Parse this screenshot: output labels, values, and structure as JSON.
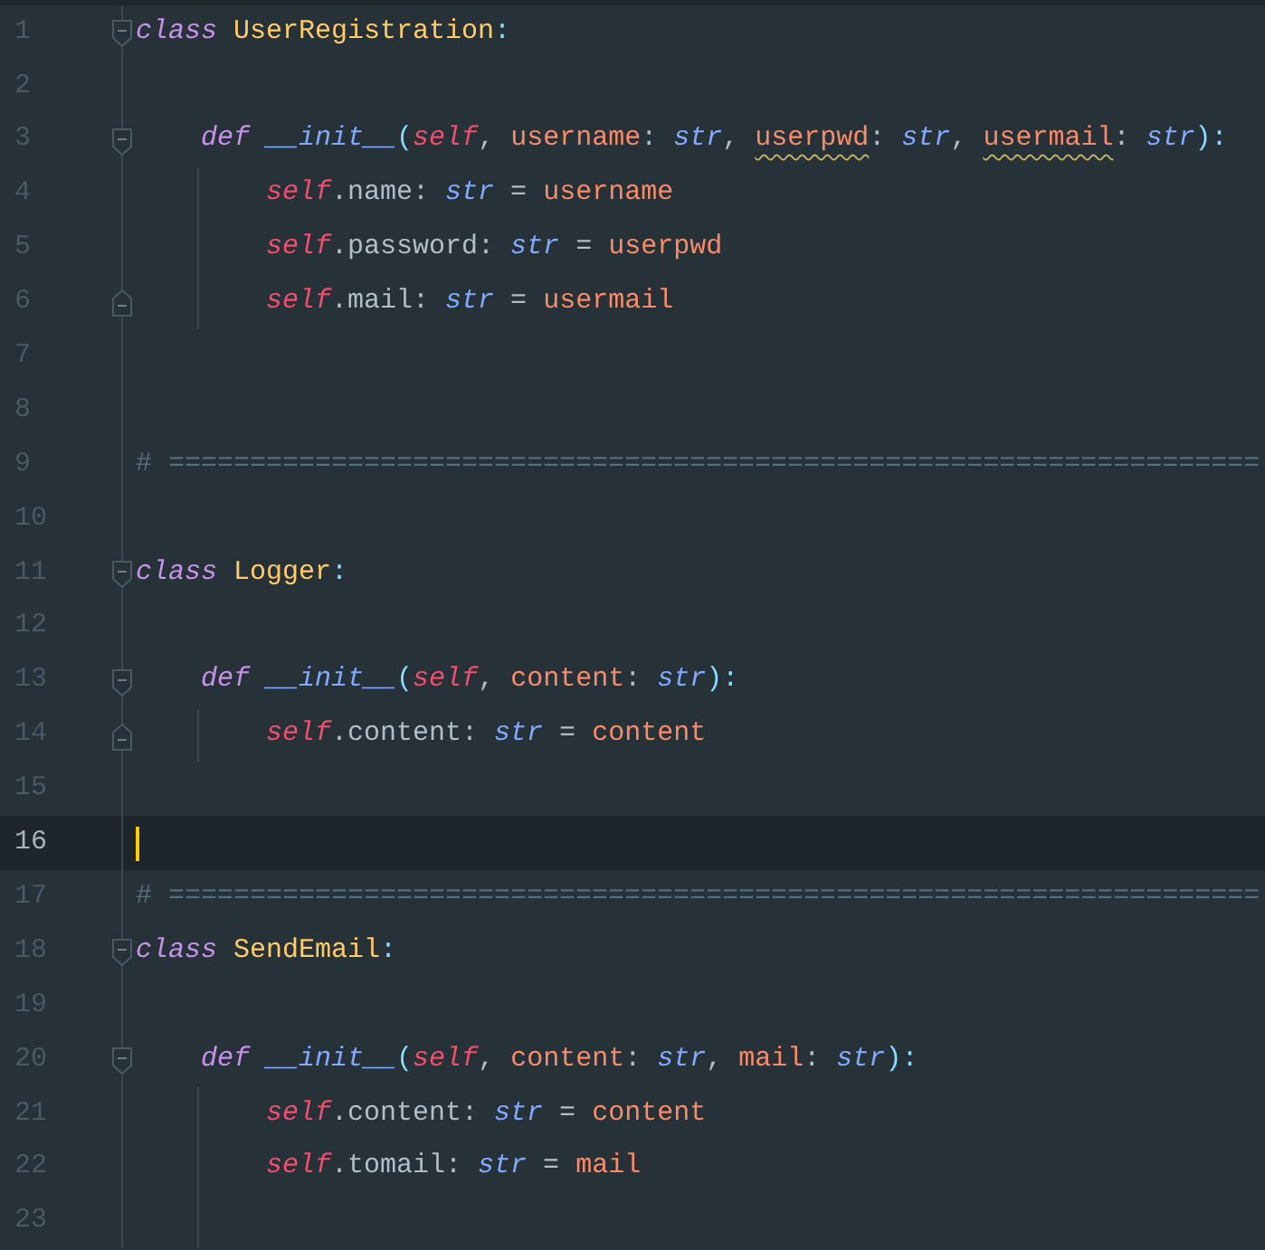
{
  "editor": {
    "lines": [
      {
        "number": "1",
        "current": false,
        "fold": {
          "kind": "start"
        },
        "tokens": [
          {
            "kind": "keyword",
            "text": "class"
          },
          {
            "kind": "classname",
            "text": "UserRegistration",
            "space_before": true
          },
          {
            "kind": "punct",
            "text": ":"
          }
        ],
        "children": [
          {
            "number": "2",
            "current": false
          },
          {
            "number": "3",
            "current": false,
            "fold": {
              "kind": "start"
            },
            "tokens": [
              {
                "kind": "keyword",
                "text": "def",
                "warning": false
              },
              {
                "kind": "function",
                "text": "__init__",
                "space_before": true,
                "warning": false
              },
              {
                "kind": "punct",
                "text": "(",
                "warning": false
              },
              {
                "kind": "self",
                "text": "self",
                "warning": false
              },
              {
                "kind": "plain",
                "text": ", ",
                "warning": false
              },
              {
                "kind": "param",
                "text": "username",
                "warning": false
              },
              {
                "kind": "plain",
                "text": ": ",
                "warning": false
              },
              {
                "kind": "type",
                "text": "str",
                "warning": false
              },
              {
                "kind": "plain",
                "text": ", ",
                "warning": false
              },
              {
                "kind": "param",
                "text": "userpwd",
                "warning": true
              },
              {
                "kind": "plain",
                "text": ": ",
                "warning": false
              },
              {
                "kind": "type",
                "text": "str",
                "warning": false
              },
              {
                "kind": "plain",
                "text": ", ",
                "warning": false
              },
              {
                "kind": "param",
                "text": "usermail",
                "warning": true
              },
              {
                "kind": "plain",
                "text": ": ",
                "warning": false
              },
              {
                "kind": "type",
                "text": "str",
                "warning": false
              },
              {
                "kind": "punct",
                "text": "):",
                "warning": false
              }
            ],
            "children": [
              {
                "number": "4",
                "current": false,
                "tokens": [
                  {
                    "kind": "self",
                    "text": "self"
                  },
                  {
                    "kind": "plain",
                    "text": ".name: "
                  },
                  {
                    "kind": "type",
                    "text": "str"
                  },
                  {
                    "kind": "plain",
                    "text": " = "
                  },
                  {
                    "kind": "param",
                    "text": "username"
                  }
                ]
              },
              {
                "number": "5",
                "current": false,
                "tokens": [
                  {
                    "kind": "self",
                    "text": "self"
                  },
                  {
                    "kind": "plain",
                    "text": ".password: "
                  },
                  {
                    "kind": "type",
                    "text": "str"
                  },
                  {
                    "kind": "plain",
                    "text": " = "
                  },
                  {
                    "kind": "param",
                    "text": "userpwd"
                  }
                ]
              },
              {
                "number": "6",
                "current": false,
                "fold": {
                  "kind": "end"
                },
                "tokens": [
                  {
                    "kind": "self",
                    "text": "self"
                  },
                  {
                    "kind": "plain",
                    "text": ".mail: "
                  },
                  {
                    "kind": "type",
                    "text": "str"
                  },
                  {
                    "kind": "plain",
                    "text": " = "
                  },
                  {
                    "kind": "param",
                    "text": "usermail"
                  }
                ]
              }
            ]
          }
        ]
      },
      {
        "number": "7",
        "current": false
      },
      {
        "number": "8",
        "current": false
      },
      {
        "number": "9",
        "current": false,
        "tokens": [
          {
            "kind": "comment",
            "text": "# ==================================================================="
          }
        ]
      },
      {
        "number": "10",
        "current": false
      },
      {
        "number": "11",
        "current": false,
        "fold": {
          "kind": "start"
        },
        "tokens": [
          {
            "kind": "keyword",
            "text": "class"
          },
          {
            "kind": "classname",
            "text": "Logger",
            "space_before": true
          },
          {
            "kind": "punct",
            "text": ":"
          }
        ],
        "children": [
          {
            "number": "12",
            "current": false
          },
          {
            "number": "13",
            "current": false,
            "fold": {
              "kind": "start"
            },
            "tokens": [
              {
                "kind": "keyword",
                "text": "def"
              },
              {
                "kind": "function",
                "text": "__init__",
                "space_before": true
              },
              {
                "kind": "punct",
                "text": "("
              },
              {
                "kind": "self",
                "text": "self"
              },
              {
                "kind": "plain",
                "text": ", "
              },
              {
                "kind": "param",
                "text": "content"
              },
              {
                "kind": "plain",
                "text": ": "
              },
              {
                "kind": "type",
                "text": "str"
              },
              {
                "kind": "punct",
                "text": "):"
              }
            ],
            "children": [
              {
                "number": "14",
                "current": false,
                "fold": {
                  "kind": "end"
                },
                "tokens": [
                  {
                    "kind": "self",
                    "text": "self"
                  },
                  {
                    "kind": "plain",
                    "text": ".content: "
                  },
                  {
                    "kind": "type",
                    "text": "str"
                  },
                  {
                    "kind": "plain",
                    "text": " = "
                  },
                  {
                    "kind": "param",
                    "text": "content"
                  }
                ]
              }
            ]
          }
        ]
      },
      {
        "number": "15",
        "current": false
      },
      {
        "number": "16",
        "current": true
      },
      {
        "number": "17",
        "current": false,
        "tokens": [
          {
            "kind": "comment",
            "text": "# ==================================================================="
          }
        ]
      },
      {
        "number": "18",
        "current": false,
        "fold": {
          "kind": "start"
        },
        "tokens": [
          {
            "kind": "keyword",
            "text": "class"
          },
          {
            "kind": "classname",
            "text": "SendEmail",
            "space_before": true
          },
          {
            "kind": "punct",
            "text": ":"
          }
        ],
        "children": [
          {
            "number": "19",
            "current": false
          },
          {
            "number": "20",
            "current": false,
            "fold": {
              "kind": "start"
            },
            "tokens": [
              {
                "kind": "keyword",
                "text": "def"
              },
              {
                "kind": "function",
                "text": "__init__",
                "space_before": true
              },
              {
                "kind": "punct",
                "text": "("
              },
              {
                "kind": "self",
                "text": "self"
              },
              {
                "kind": "plain",
                "text": ", "
              },
              {
                "kind": "param",
                "text": "content"
              },
              {
                "kind": "plain",
                "text": ": "
              },
              {
                "kind": "type",
                "text": "str"
              },
              {
                "kind": "plain",
                "text": ", "
              },
              {
                "kind": "param",
                "text": "mail"
              },
              {
                "kind": "plain",
                "text": ": "
              },
              {
                "kind": "type",
                "text": "str"
              },
              {
                "kind": "punct",
                "text": "):"
              }
            ],
            "children": [
              {
                "number": "21",
                "current": false,
                "tokens": [
                  {
                    "kind": "self",
                    "text": "self"
                  },
                  {
                    "kind": "plain",
                    "text": ".content: "
                  },
                  {
                    "kind": "type",
                    "text": "str"
                  },
                  {
                    "kind": "plain",
                    "text": " = "
                  },
                  {
                    "kind": "param",
                    "text": "content"
                  }
                ]
              },
              {
                "number": "22",
                "current": false,
                "tokens": [
                  {
                    "kind": "self",
                    "text": "self"
                  },
                  {
                    "kind": "plain",
                    "text": ".tomail: "
                  },
                  {
                    "kind": "type",
                    "text": "str"
                  },
                  {
                    "kind": "plain",
                    "text": " = "
                  },
                  {
                    "kind": "param",
                    "text": "mail"
                  }
                ]
              },
              {
                "number": "23",
                "current": false
              }
            ]
          }
        ]
      }
    ]
  }
}
